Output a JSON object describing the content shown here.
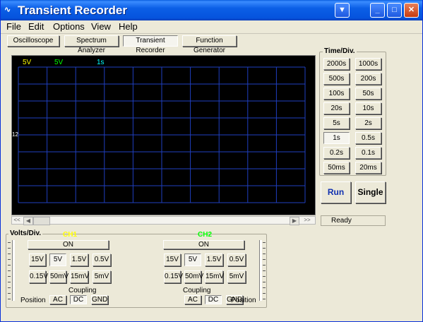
{
  "window": {
    "title": "Transient Recorder",
    "app_icon": "oscilloscope-icon"
  },
  "menu": [
    "File",
    "Edit",
    "Options",
    "View",
    "Help"
  ],
  "toolbar": {
    "tabs": [
      "Oscilloscope",
      "Spectrum Analyzer",
      "Transient Recorder",
      "Function Generator"
    ],
    "selected": "Transient Recorder"
  },
  "scope": {
    "ch1_volts": "5V",
    "ch2_volts": "5V",
    "timebase": "1s",
    "marker": "12",
    "colors": {
      "ch1": "#ffff00",
      "ch2": "#00ff00",
      "time": "#00ffff",
      "grid": "#1f3fbf",
      "background": "#000000"
    }
  },
  "timediv": {
    "title": "Time/Div.",
    "options": [
      "2000s",
      "1000s",
      "500s",
      "200s",
      "100s",
      "50s",
      "20s",
      "10s",
      "5s",
      "2s",
      "1s",
      "0.5s",
      "0.2s",
      "0.1s",
      "50ms",
      "20ms"
    ],
    "selected": "1s"
  },
  "controls": {
    "run": "Run",
    "single": "Single"
  },
  "status": "Ready",
  "volts": {
    "title": "Volts/Div.",
    "ch1": {
      "label": "CH1",
      "label_color": "#ffff00",
      "on": "ON",
      "ranges": [
        "15V",
        "5V",
        "1.5V",
        "0.5V",
        "0.15V",
        "50mV",
        "15mV",
        "5mV"
      ],
      "selected": "5V",
      "coupling_label": "Coupling",
      "coupling": [
        "AC",
        "DC",
        "GND"
      ],
      "coupling_selected": "DC",
      "position_label": "Position"
    },
    "ch2": {
      "label": "CH2",
      "label_color": "#00ff00",
      "on": "ON",
      "ranges": [
        "15V",
        "5V",
        "1.5V",
        "0.5V",
        "0.15V",
        "50mV",
        "15mV",
        "5mV"
      ],
      "selected": "5V",
      "coupling_label": "Coupling",
      "coupling": [
        "AC",
        "DC",
        "GND"
      ],
      "coupling_selected": "DC",
      "position_label": "Position"
    }
  }
}
